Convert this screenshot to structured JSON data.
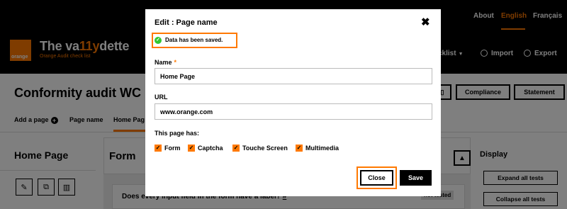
{
  "topbar": {
    "languages": [
      {
        "label": "About"
      },
      {
        "label": "English",
        "active": true
      },
      {
        "label": "Français"
      }
    ]
  },
  "header": {
    "logo_text": "orange",
    "app_title_prefix": "The va",
    "app_title_highlight": "11y",
    "app_title_suffix": "dette",
    "app_subtitle": "Orange Audit check list",
    "nav": {
      "checklist": "cklist",
      "import": "Import",
      "export": "Export"
    }
  },
  "page": {
    "title": "Conformity audit WC",
    "buttons": {
      "compliance": "Compliance",
      "statement": "Statement"
    },
    "tabs": {
      "add_page": "Add a page",
      "page_name": "Page name",
      "home_page": "Home Pag"
    }
  },
  "left_panel": {
    "title": "Home Page"
  },
  "center_panel": {
    "title": "Form",
    "question": "Does every input field in the form have a label?",
    "question_anchor": "#",
    "status": "not tested"
  },
  "right_panel": {
    "title": "Display",
    "expand": "Expand all tests",
    "collapse": "Collapse all tests"
  },
  "modal": {
    "title": "Edit : Page name",
    "close_icon": "✖",
    "alert": "Data has been saved.",
    "name_label": "Name",
    "required_mark": "*",
    "name_value": "Home Page",
    "url_label": "URL",
    "url_value": "www.orange.com",
    "has_label": "This page has:",
    "checkboxes": {
      "form": "Form",
      "captcha": "Captcha",
      "touch": "Touche Screen",
      "multimedia": "Multimedia"
    },
    "close_button": "Close",
    "save_button": "Save"
  },
  "colors": {
    "accent": "#ff7900",
    "success": "#32c832"
  }
}
